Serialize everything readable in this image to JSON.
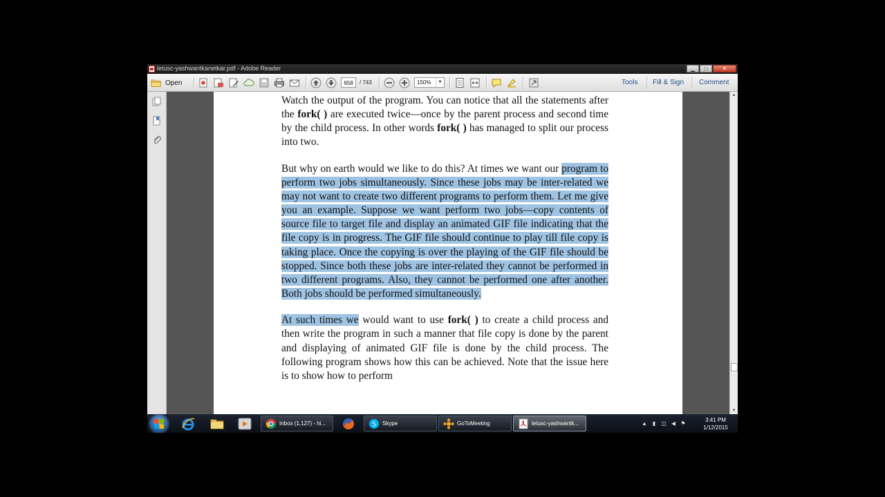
{
  "window": {
    "title": "letusc-yashwantkanetkar.pdf - Adobe Reader",
    "minimize_label": "▁",
    "maximize_label": "□",
    "close_label": "✕"
  },
  "toolbar": {
    "open_label": "Open",
    "page_current": "658",
    "page_total": "/ 743",
    "zoom": "150%",
    "tools_label": "Tools",
    "fill_sign_label": "Fill & Sign",
    "comment_label": "Comment"
  },
  "document": {
    "p1_a": "Watch the output of the program. You can notice that all the statements after the ",
    "p1_b": "fork( )",
    "p1_c": " are executed twice—once by the parent process and second time by the child process. In other words ",
    "p1_d": "fork( )",
    "p1_e": " has managed to split our process into two.",
    "p2_a": "But why on earth would we like to do this? At times we want our ",
    "p2_hl": "program to perform two jobs simultaneously. Since these jobs may be inter-related we may not want to create two different programs to perform them. Let me give you an example. Suppose we want perform two jobs—copy contents of source file to target file and display an animated GIF file indicating that the file copy is in progress. The GIF file should continue to play till file copy is taking place. Once the copying is over the playing of the GIF file should be stopped. Since both these jobs are inter-related they cannot be performed in two different programs. Also, they cannot be performed one after another. Both jobs should be performed simultaneously.",
    "p3_hl": "At such times we",
    "p3_a": " would want to use ",
    "p3_b": "fork( )",
    "p3_c": " to create a child process and then write the program in such a manner that file copy is done by the parent and displaying of animated GIF file is done by the child process. The following program shows how this can be achieved. Note that the issue here is to show how to perform"
  },
  "taskbar": {
    "tasks": [
      {
        "label": "Inbox (1,127) - hi..."
      },
      {
        "label": "Skype"
      },
      {
        "label": "GoToMeeting"
      },
      {
        "label": "letusc-yashwantk..."
      }
    ],
    "clock_time": "3:41 PM",
    "clock_date": "1/12/2015"
  },
  "icons": {
    "open": "folder-icon",
    "create": "create-pdf-icon",
    "print": "printer-icon",
    "email": "email-icon",
    "prev": "arrow-up-icon",
    "next": "arrow-down-icon",
    "zoom_out": "zoom-out-icon",
    "zoom_in": "zoom-in-icon",
    "comment": "sticky-note-icon",
    "highlight": "highlight-icon"
  },
  "colors": {
    "selection": "#9fc3e3",
    "link": "#1f4e8c",
    "close_button": "#c33a26"
  }
}
